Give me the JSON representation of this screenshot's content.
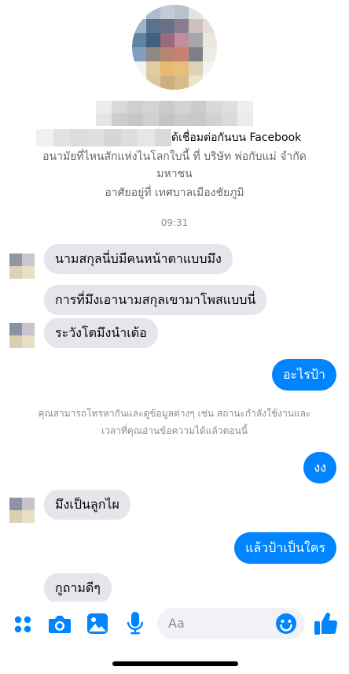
{
  "profile": {
    "connection_text": "ด้เชื่อมต่อกันบน Facebook",
    "work_line1": "อนามัยที่ไหนสักแห่งไนโลกใบนี้ ที่ บริษัท พ่อกับแม่ จำกัด",
    "work_line2": "มหาชน",
    "lives_in": "อาศัยอยู่ที่ เทศบาลเมืองชัยภูมิ"
  },
  "timestamp": "09:31",
  "messages": {
    "m1": "นามสกุลนี่บ่มีคนหน้าตาแบบมึง",
    "m2": "การที่มึงเอานามสกุลเขามาโพสแบบนี่",
    "m3": "ระวังโตมึงนำเด้อ",
    "m4": "อะไรป้า",
    "m5": "งง",
    "m6": "มึงเป็นลูกไผ",
    "m7": "แล้วป้าเป็นใคร",
    "m8": "กูถามดีๆ"
  },
  "notice": {
    "line1": "คุณสามารถโทรหากันและดูข้อมูลต่างๆ เช่น สถานะกำลังใช้งานและ",
    "line2": "เวลาที่คุณอ่านข้อความได้แล้วตอนนี้"
  },
  "composer": {
    "placeholder": "Aa",
    "icons": [
      "apps-icon",
      "camera-icon",
      "gallery-icon",
      "microphone-icon",
      "emoji-icon",
      "like-icon"
    ]
  },
  "colors": {
    "accent": "#0084ff",
    "incoming_bubble": "#e4e6eb"
  }
}
